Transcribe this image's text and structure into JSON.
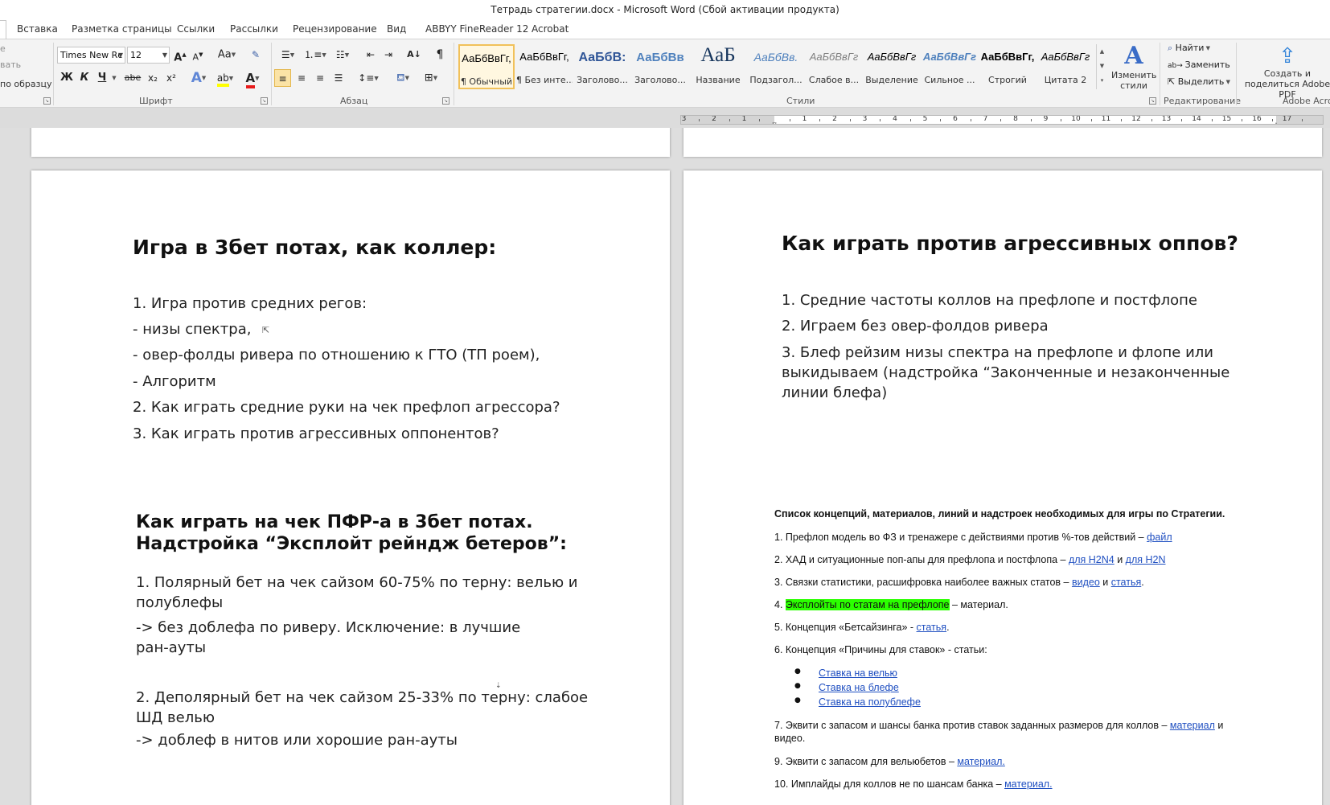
{
  "window": {
    "title": "Тетрадь стратегии.docx  -  Microsoft Word (Сбой активации продукта)"
  },
  "tabs": [
    "Вставка",
    "Разметка страницы",
    "Ссылки",
    "Рассылки",
    "Рецензирование",
    "Вид",
    "ABBYY FineReader 12",
    "Acrobat"
  ],
  "ribbon": {
    "clipboard_fragments": [
      "е",
      "вать",
      "по образцу"
    ],
    "font": {
      "name": "Times New Rc",
      "size": "12",
      "group_label": "Шрифт",
      "grow": "A",
      "shrink": "A",
      "change_case": "Aa",
      "bold": "Ж",
      "italic": "К",
      "underline": "Ч",
      "strike": "abe",
      "subscript": "x₂",
      "superscript": "x²",
      "text_effect": "A",
      "highlight": "ab",
      "font_color": "A"
    },
    "paragraph": {
      "group_label": "Абзац",
      "show_marks": "¶",
      "sort": "A↓"
    },
    "styles": {
      "group_label": "Стили",
      "items": [
        {
          "sample": "АаБбВвГг,",
          "name": "¶ Обычный",
          "selected": true
        },
        {
          "sample": "АаБбВвГг,",
          "name": "¶ Без инте...",
          "selected": false
        },
        {
          "sample": "АаБбВ:",
          "name": "Заголово...",
          "selected": false
        },
        {
          "sample": "АаБбВв",
          "name": "Заголово...",
          "selected": false
        },
        {
          "sample": "АаБ",
          "name": "Название",
          "selected": false
        },
        {
          "sample": "АаБбВв.",
          "name": "Подзагол...",
          "selected": false
        },
        {
          "sample": "АаБбВвГг",
          "name": "Слабое в...",
          "selected": false
        },
        {
          "sample": "АаБбВвГг",
          "name": "Выделение",
          "selected": false
        },
        {
          "sample": "АаБбВвГг",
          "name": "Сильное ...",
          "selected": false
        },
        {
          "sample": "АаБбВвГг,",
          "name": "Строгий",
          "selected": false
        },
        {
          "sample": "АаБбВвГг",
          "name": "Цитата 2",
          "selected": false
        }
      ],
      "change_styles": "Изменить стили"
    },
    "editing": {
      "group_label": "Редактирование",
      "find": "Найти",
      "replace": "Заменить",
      "select": "Выделить"
    },
    "adobe": {
      "group_label": "Adobe Acro",
      "create_share": "Создать и поделиться Adobe PDF"
    },
    "colors": {
      "accent_selected": "#f1c15a",
      "font_color_bar": "#e81b1b",
      "highlight_bar": "#ffff00"
    }
  },
  "ruler": {
    "numbers": [
      "3",
      "2",
      "1",
      "1",
      "2",
      "3",
      "4",
      "5",
      "6",
      "7",
      "8",
      "9",
      "10",
      "11",
      "12",
      "13",
      "14",
      "15",
      "16",
      "17"
    ]
  },
  "document": {
    "left_page": {
      "heading1": "Игра в 3бет потах, как коллер:",
      "list1": [
        "1. Игра против средних регов:",
        "- низы спектра,",
        "- овер-фолды ривера по отношению к ГТО (ТП роем),",
        "- Алгоритм",
        "2. Как играть средние руки на чек префлоп агрессора?",
        "3. Как играть против агрессивных оппонентов?"
      ],
      "heading2_line1": "Как играть на чек ПФР-а в 3бет потах.",
      "heading2_line2": "Надстройка “Эксплойт рейндж бетеров”:",
      "para1": "1. Полярный бет на чек сайзом 60-75% по терну: велью и полублефы",
      "para2": "-> без доблефа по риверу. Исключение: в лучшие ран-ауты",
      "para3": "2. Деполярный бет на чек сайзом 25-33% по терну: слабое ШД велью",
      "para4": "-> доблеф в нитов или хорошие ран-ауты"
    },
    "right_page": {
      "heading": "Как играть против агрессивных оппов?",
      "items": [
        "1. Средние частоты коллов на префлопе и постфлопе",
        "2. Играем без овер-фолдов ривера",
        "3. Блеф рейзим низы спектра на префлопе и флопе или выкидываем (надстройка “Законченные и незаконченные линии блефа)"
      ],
      "concepts_title": "Список концепций, материалов, линий и надстроек необходимых для игры по Стратегии.",
      "c1_text": "1. Префлоп модель во ФЗ и тренажере с действиями против %-тов действий – ",
      "c1_link": "файл",
      "c2_text": "2. ХАД и ситуационные поп-апы для префлопа и постфлопа – ",
      "c2_link1": "для H2N4",
      "c2_mid": " и ",
      "c2_link2": "для H2N",
      "c3_text": "3. Связки статистики, расшифровка наиболее важных статов – ",
      "c3_link1": "видео",
      "c3_mid": " и ",
      "c3_link2": "статья",
      "c3_end": ".",
      "c4_num": "4. ",
      "c4_highlight": "Эксплойты по статам на префлопе",
      "c4_text": " – материал.",
      "c5_text": "5. Концепция «Бетсайзинга» - ",
      "c5_link": "статья",
      "c5_end": ".",
      "c6_text": "6. Концепция «Причины для ставок» - статьи:",
      "bullets": [
        "Ставка на велью",
        "Ставка на блефе",
        "Ставка на полублефе"
      ],
      "c7_text": "7. Эквити с запасом и шансы банка против ставок заданных размеров для коллов – ",
      "c7_link": "материал",
      "c7_end": " и видео.",
      "c9_text": "9. Эквити с запасом для вельюбетов – ",
      "c9_link": "материал.",
      "c10_text": "10. Имплайды для коллов не по шансам банка – ",
      "c10_link": "материал."
    }
  }
}
